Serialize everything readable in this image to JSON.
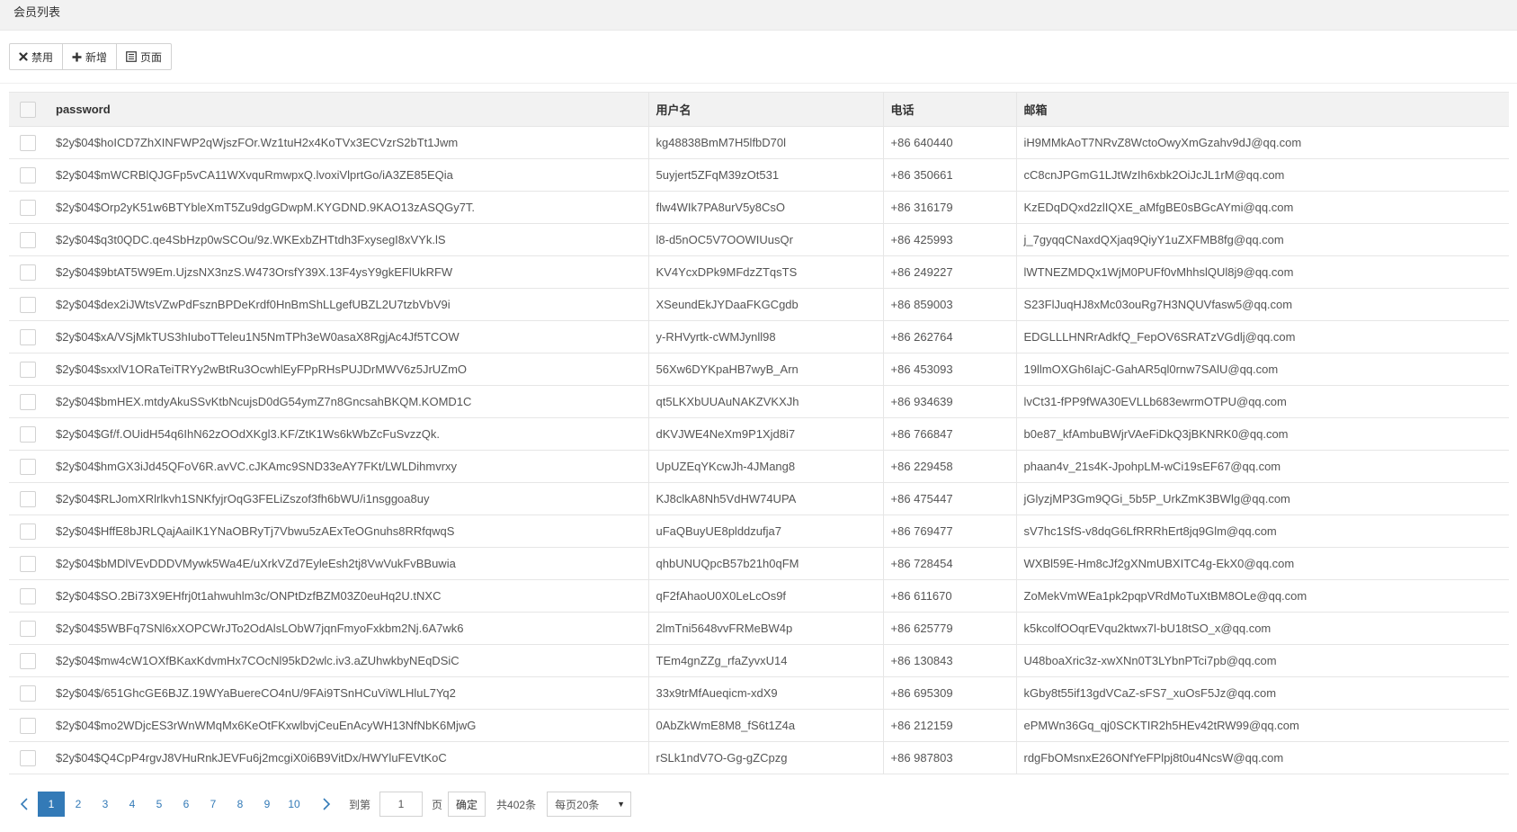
{
  "title": "会员列表",
  "toolbar": {
    "disable_label": "禁用",
    "add_label": "新增",
    "page_label": "页面"
  },
  "table": {
    "headers": [
      "password",
      "用户名",
      "电话",
      "邮箱"
    ],
    "rows": [
      [
        "$2y$04$hoICD7ZhXINFWP2qWjszFOr.Wz1tuH2x4KoTVx3ECVzrS2bTt1Jwm",
        "kg48838BmM7H5lfbD70l",
        "+86 640440",
        "iH9MMkAoT7NRvZ8WctoOwyXmGzahv9dJ@qq.com"
      ],
      [
        "$2y$04$mWCRBlQJGFp5vCA11WXvquRmwpxQ.lvoxiVlprtGo/iA3ZE85EQia",
        "5uyjert5ZFqM39zOt531",
        "+86 350661",
        "cC8cnJPGmG1LJtWzIh6xbk2OiJcJL1rM@qq.com"
      ],
      [
        "$2y$04$Orp2yK51w6BTYbleXmT5Zu9dgGDwpM.KYGDND.9KAO13zASQGy7T.",
        "flw4WIk7PA8urV5y8CsO",
        "+86 316179",
        "KzEDqDQxd2zlIQXE_aMfgBE0sBGcAYmi@qq.com"
      ],
      [
        "$2y$04$q3t0QDC.qe4SbHzp0wSCOu/9z.WKExbZHTtdh3FxysegI8xVYk.lS",
        "l8-d5nOC5V7OOWIUusQr",
        "+86 425993",
        "j_7gyqqCNaxdQXjaq9QiyY1uZXFMB8fg@qq.com"
      ],
      [
        "$2y$04$9btAT5W9Em.UjzsNX3nzS.W473OrsfY39X.13F4ysY9gkEFlUkRFW",
        "KV4YcxDPk9MFdzZTqsTS",
        "+86 249227",
        "lWTNEZMDQx1WjM0PUFf0vMhhslQUl8j9@qq.com"
      ],
      [
        "$2y$04$dex2iJWtsVZwPdFsznBPDeKrdf0HnBmShLLgefUBZL2U7tzbVbV9i",
        "XSeundEkJYDaaFKGCgdb",
        "+86 859003",
        "S23FlJuqHJ8xMc03ouRg7H3NQUVfasw5@qq.com"
      ],
      [
        "$2y$04$xA/VSjMkTUS3hIuboTTeleu1N5NmTPh3eW0asaX8RgjAc4Jf5TCOW",
        "y-RHVyrtk-cWMJynll98",
        "+86 262764",
        "EDGLLLHNRrAdkfQ_FepOV6SRATzVGdlj@qq.com"
      ],
      [
        "$2y$04$sxxlV1ORaTeiTRYy2wBtRu3OcwhlEyFPpRHsPUJDrMWV6z5JrUZmO",
        "56Xw6DYKpaHB7wyB_Arn",
        "+86 453093",
        "19llmOXGh6IajC-GahAR5ql0rnw7SAlU@qq.com"
      ],
      [
        "$2y$04$bmHEX.mtdyAkuSSvKtbNcujsD0dG54ymZ7n8GncsahBKQM.KOMD1C",
        "qt5LKXbUUAuNAKZVKXJh",
        "+86 934639",
        "lvCt31-fPP9fWA30EVLLb683ewrmOTPU@qq.com"
      ],
      [
        "$2y$04$Gf/f.OUidH54q6IhN62zOOdXKgl3.KF/ZtK1Ws6kWbZcFuSvzzQk.",
        "dKVJWE4NeXm9P1Xjd8i7",
        "+86 766847",
        "b0e87_kfAmbuBWjrVAeFiDkQ3jBKNRK0@qq.com"
      ],
      [
        "$2y$04$hmGX3iJd45QFoV6R.avVC.cJKAmc9SND33eAY7FKt/LWLDihmvrxy",
        "UpUZEqYKcwJh-4JMang8",
        "+86 229458",
        "phaan4v_21s4K-JpohpLM-wCi19sEF67@qq.com"
      ],
      [
        "$2y$04$RLJomXRlrlkvh1SNKfyjrOqG3FELiZszof3fh6bWU/i1nsggoa8uy",
        "KJ8clkA8Nh5VdHW74UPA",
        "+86 475447",
        "jGlyzjMP3Gm9QGi_5b5P_UrkZmK3BWlg@qq.com"
      ],
      [
        "$2y$04$HffE8bJRLQajAaiIK1YNaOBRyTj7Vbwu5zAExTeOGnuhs8RRfqwqS",
        "uFaQBuyUE8plddzufja7",
        "+86 769477",
        "sV7hc1SfS-v8dqG6LfRRRhErt8jq9Glm@qq.com"
      ],
      [
        "$2y$04$bMDlVEvDDDVMywk5Wa4E/uXrkVZd7EyleEsh2tj8VwVukFvBBuwia",
        "qhbUNUQpcB57b21h0qFM",
        "+86 728454",
        "WXBl59E-Hm8cJf2gXNmUBXITC4g-EkX0@qq.com"
      ],
      [
        "$2y$04$SO.2Bi73X9EHfrj0t1ahwuhlm3c/ONPtDzfBZM03Z0euHq2U.tNXC",
        "qF2fAhaoU0X0LeLcOs9f",
        "+86 611670",
        "ZoMekVmWEa1pk2pqpVRdMoTuXtBM8OLe@qq.com"
      ],
      [
        "$2y$04$5WBFq7SNl6xXOPCWrJTo2OdAlsLObW7jqnFmyoFxkbm2Nj.6A7wk6",
        "2lmTni5648vvFRMeBW4p",
        "+86 625779",
        "k5kcolfOOqrEVqu2ktwx7l-bU18tSO_x@qq.com"
      ],
      [
        "$2y$04$mw4cW1OXfBKaxKdvmHx7COcNl95kD2wlc.iv3.aZUhwkbyNEqDSiC",
        "TEm4gnZZg_rfaZyvxU14",
        "+86 130843",
        "U48boaXric3z-xwXNn0T3LYbnPTci7pb@qq.com"
      ],
      [
        "$2y$04$/651GhcGE6BJZ.19WYaBuereCO4nU/9FAi9TSnHCuViWLHluL7Yq2",
        "33x9trMfAueqicm-xdX9",
        "+86 695309",
        "kGby8t55if13gdVCaZ-sFS7_xuOsF5Jz@qq.com"
      ],
      [
        "$2y$04$mo2WDjcES3rWnWMqMx6KeOtFKxwlbvjCeuEnAcyWH13NfNbK6MjwG",
        "0AbZkWmE8M8_fS6t1Z4a",
        "+86 212159",
        "ePMWn36Gq_qj0SCKTIR2h5HEv42tRW99@qq.com"
      ],
      [
        "$2y$04$Q4CpP4rgvJ8VHuRnkJEVFu6j2mcgiX0i6B9VitDx/HWYluFEVtKoC",
        "rSLk1ndV7O-Gg-gZCpzg",
        "+86 987803",
        "rdgFbOMsnxE26ONfYeFPlpj8t0u4NcsW@qq.com"
      ]
    ]
  },
  "pagination": {
    "pages": [
      "1",
      "2",
      "3",
      "4",
      "5",
      "6",
      "7",
      "8",
      "9",
      "10"
    ],
    "current_page": "1",
    "goto_label": "到第",
    "goto_value": "1",
    "page_suffix": "页",
    "confirm_label": "确定",
    "total_label": "共402条",
    "per_page_label": "每页20条"
  }
}
